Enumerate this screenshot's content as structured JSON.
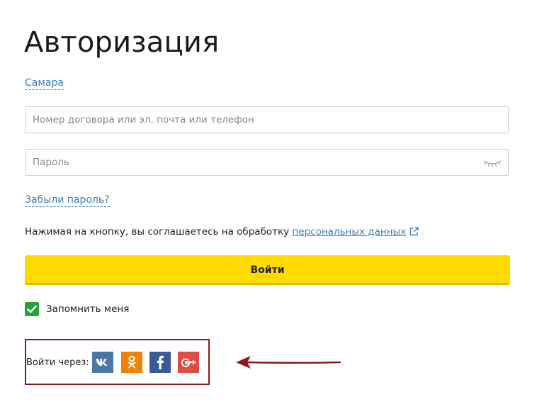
{
  "page": {
    "title": "Авторизация",
    "city_link": "Самара"
  },
  "form": {
    "login_placeholder": "Номер договора или эл. почта или телефон",
    "password_placeholder": "Пароль",
    "forgot_password": "Забыли пароль?",
    "consent_text": "Нажимая на кнопку, вы соглашаетесь на обработку ",
    "consent_link": "персональных данных",
    "submit_label": "Войти",
    "remember_label": "Запомнить меня",
    "remember_checked": true
  },
  "social": {
    "label": "Войти через:",
    "buttons": [
      {
        "name": "vk",
        "glyph": "vk",
        "color": "#4a76a8"
      },
      {
        "name": "odnoklassniki",
        "glyph": "ok",
        "color": "#ee8208"
      },
      {
        "name": "facebook",
        "glyph": "f",
        "color": "#3b5998"
      },
      {
        "name": "google-plus",
        "glyph": "G+",
        "color": "#dc4e41"
      }
    ]
  },
  "colors": {
    "accent_yellow": "#ffdb00",
    "link_blue": "#3d7fb8",
    "checkbox_green": "#23a339",
    "annotation_red": "#8b1a1f"
  },
  "icons": [
    "eye-closed-icon",
    "external-link-icon",
    "checkmark-icon",
    "vk-icon",
    "odnoklassniki-icon",
    "facebook-icon",
    "google-plus-icon",
    "arrow-left-icon"
  ]
}
